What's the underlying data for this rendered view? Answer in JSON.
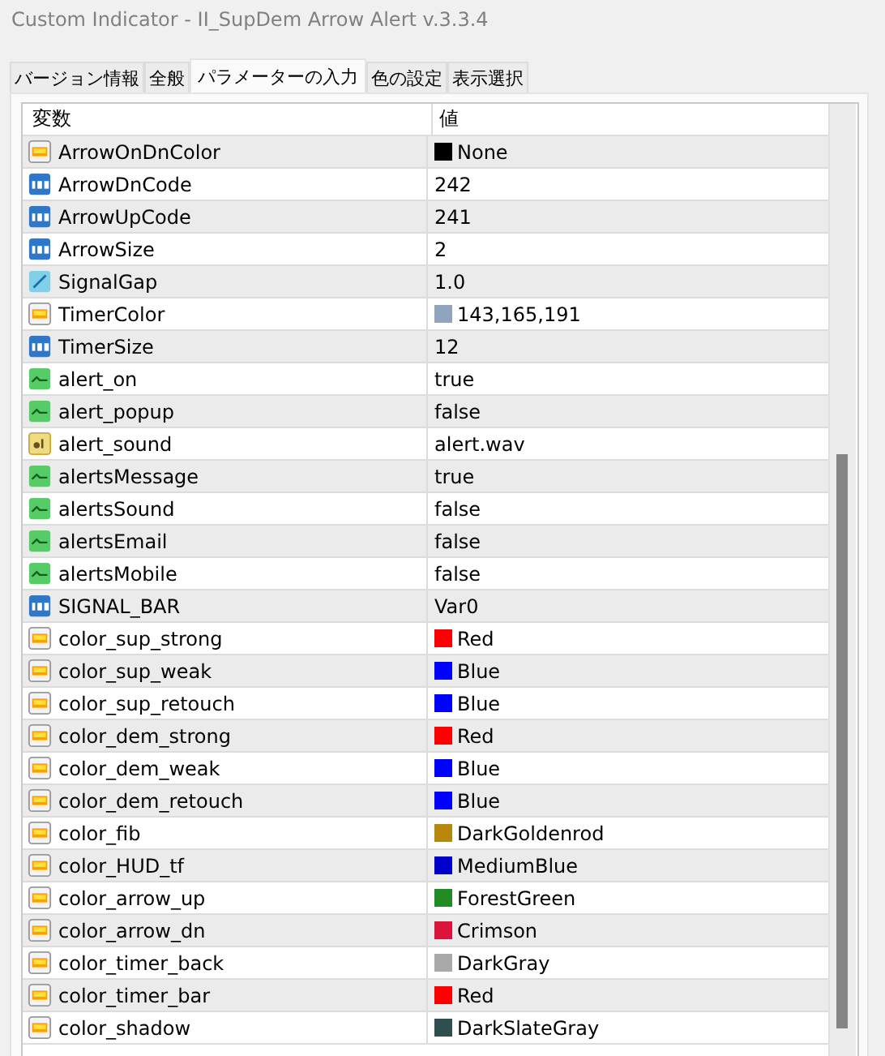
{
  "window": {
    "title": "Custom Indicator - II_SupDem Arrow Alert v.3.3.4"
  },
  "tabs": [
    {
      "label": "バージョン情報",
      "selected": false
    },
    {
      "label": "全般",
      "selected": false
    },
    {
      "label": "パラメーターの入力",
      "selected": true
    },
    {
      "label": "色の設定",
      "selected": false
    },
    {
      "label": "表示選択",
      "selected": false
    }
  ],
  "table": {
    "columns": [
      "変数",
      "値"
    ],
    "rows": [
      {
        "kind": "color",
        "name": "ArrowOnDnColor",
        "value": "None",
        "color": "#000000"
      },
      {
        "kind": "int",
        "name": "ArrowDnCode",
        "value": "242"
      },
      {
        "kind": "int",
        "name": "ArrowUpCode",
        "value": "241"
      },
      {
        "kind": "int",
        "name": "ArrowSize",
        "value": "2"
      },
      {
        "kind": "double",
        "name": "SignalGap",
        "value": "1.0"
      },
      {
        "kind": "color",
        "name": "TimerColor",
        "value": "143,165,191",
        "color": "#8fa5bf"
      },
      {
        "kind": "int",
        "name": "TimerSize",
        "value": "12"
      },
      {
        "kind": "bool",
        "name": "alert_on",
        "value": "true"
      },
      {
        "kind": "bool",
        "name": "alert_popup",
        "value": "false"
      },
      {
        "kind": "string",
        "name": "alert_sound",
        "value": "alert.wav"
      },
      {
        "kind": "bool",
        "name": "alertsMessage",
        "value": "true"
      },
      {
        "kind": "bool",
        "name": "alertsSound",
        "value": "false"
      },
      {
        "kind": "bool",
        "name": "alertsEmail",
        "value": "false"
      },
      {
        "kind": "bool",
        "name": "alertsMobile",
        "value": "false"
      },
      {
        "kind": "int",
        "name": "SIGNAL_BAR",
        "value": "Var0"
      },
      {
        "kind": "color",
        "name": "color_sup_strong",
        "value": "Red",
        "color": "#ff0000"
      },
      {
        "kind": "color",
        "name": "color_sup_weak",
        "value": "Blue",
        "color": "#0000ff"
      },
      {
        "kind": "color",
        "name": "color_sup_retouch",
        "value": "Blue",
        "color": "#0000ff"
      },
      {
        "kind": "color",
        "name": "color_dem_strong",
        "value": "Red",
        "color": "#ff0000"
      },
      {
        "kind": "color",
        "name": "color_dem_weak",
        "value": "Blue",
        "color": "#0000ff"
      },
      {
        "kind": "color",
        "name": "color_dem_retouch",
        "value": "Blue",
        "color": "#0000ff"
      },
      {
        "kind": "color",
        "name": "color_fib",
        "value": "DarkGoldenrod",
        "color": "#b8860b"
      },
      {
        "kind": "color",
        "name": "color_HUD_tf",
        "value": "MediumBlue",
        "color": "#0000cd"
      },
      {
        "kind": "color",
        "name": "color_arrow_up",
        "value": "ForestGreen",
        "color": "#228b22"
      },
      {
        "kind": "color",
        "name": "color_arrow_dn",
        "value": "Crimson",
        "color": "#dc143c"
      },
      {
        "kind": "color",
        "name": "color_timer_back",
        "value": "DarkGray",
        "color": "#a9a9a9"
      },
      {
        "kind": "color",
        "name": "color_timer_bar",
        "value": "Red",
        "color": "#ff0000"
      },
      {
        "kind": "color",
        "name": "color_shadow",
        "value": "DarkSlateGray",
        "color": "#2f4f4f"
      }
    ]
  }
}
